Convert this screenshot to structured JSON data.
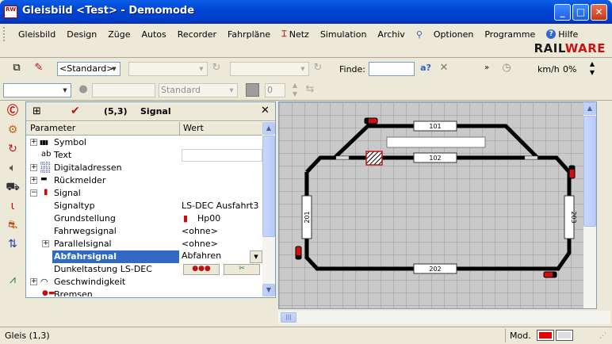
{
  "window": {
    "title": "Gleisbild <Test> - Demomode",
    "app_icon_text": "RW"
  },
  "menu": {
    "items": [
      "Gleisbild",
      "Design",
      "Züge",
      "Autos",
      "Recorder",
      "Fahrpläne",
      "Netz",
      "Simulation",
      "Archiv",
      "Optionen",
      "Programme",
      "Hilfe"
    ]
  },
  "logo": {
    "rail": "RAIL",
    "ware": "WARE"
  },
  "toolbar": {
    "view_combo": "<Standard>",
    "find_label": "Finde:",
    "find_value": "",
    "speed_unit": "km/h",
    "speed_value": "0%",
    "style_combo": "Standard",
    "numeric_value": "0"
  },
  "panel": {
    "position": "(5,3)",
    "title": "Signal",
    "col_param": "Parameter",
    "col_value": "Wert",
    "rows": [
      {
        "label": "Symbol",
        "value": ""
      },
      {
        "label": "Text",
        "value": ""
      },
      {
        "label": "Digitaladressen",
        "value": ""
      },
      {
        "label": "Rückmelder",
        "value": ""
      },
      {
        "label": "Signal",
        "value": ""
      },
      {
        "label": "Signaltyp",
        "value": "LS-DEC Ausfahrt3"
      },
      {
        "label": "Grundstellung",
        "value": "Hp00"
      },
      {
        "label": "Fahrwegsignal",
        "value": "<ohne>"
      },
      {
        "label": "Parallelsignal",
        "value": "<ohne>"
      },
      {
        "label": "Abfahrsignal",
        "value": "Abfahren"
      },
      {
        "label": "Dunkeltastung LS-DEC",
        "value": ""
      },
      {
        "label": "Geschwindigkeit",
        "value": ""
      },
      {
        "label": "Bremsen",
        "value": ""
      }
    ]
  },
  "layout": {
    "blocks": [
      "101",
      "102",
      "201",
      "202",
      "203"
    ]
  },
  "status": {
    "position": "Gleis (1,3)",
    "mode": "Mod."
  },
  "colors": {
    "title_blue": "#0046d5",
    "track": "#000000",
    "selection": "#d01010",
    "highlight_row": "#316ac5"
  }
}
